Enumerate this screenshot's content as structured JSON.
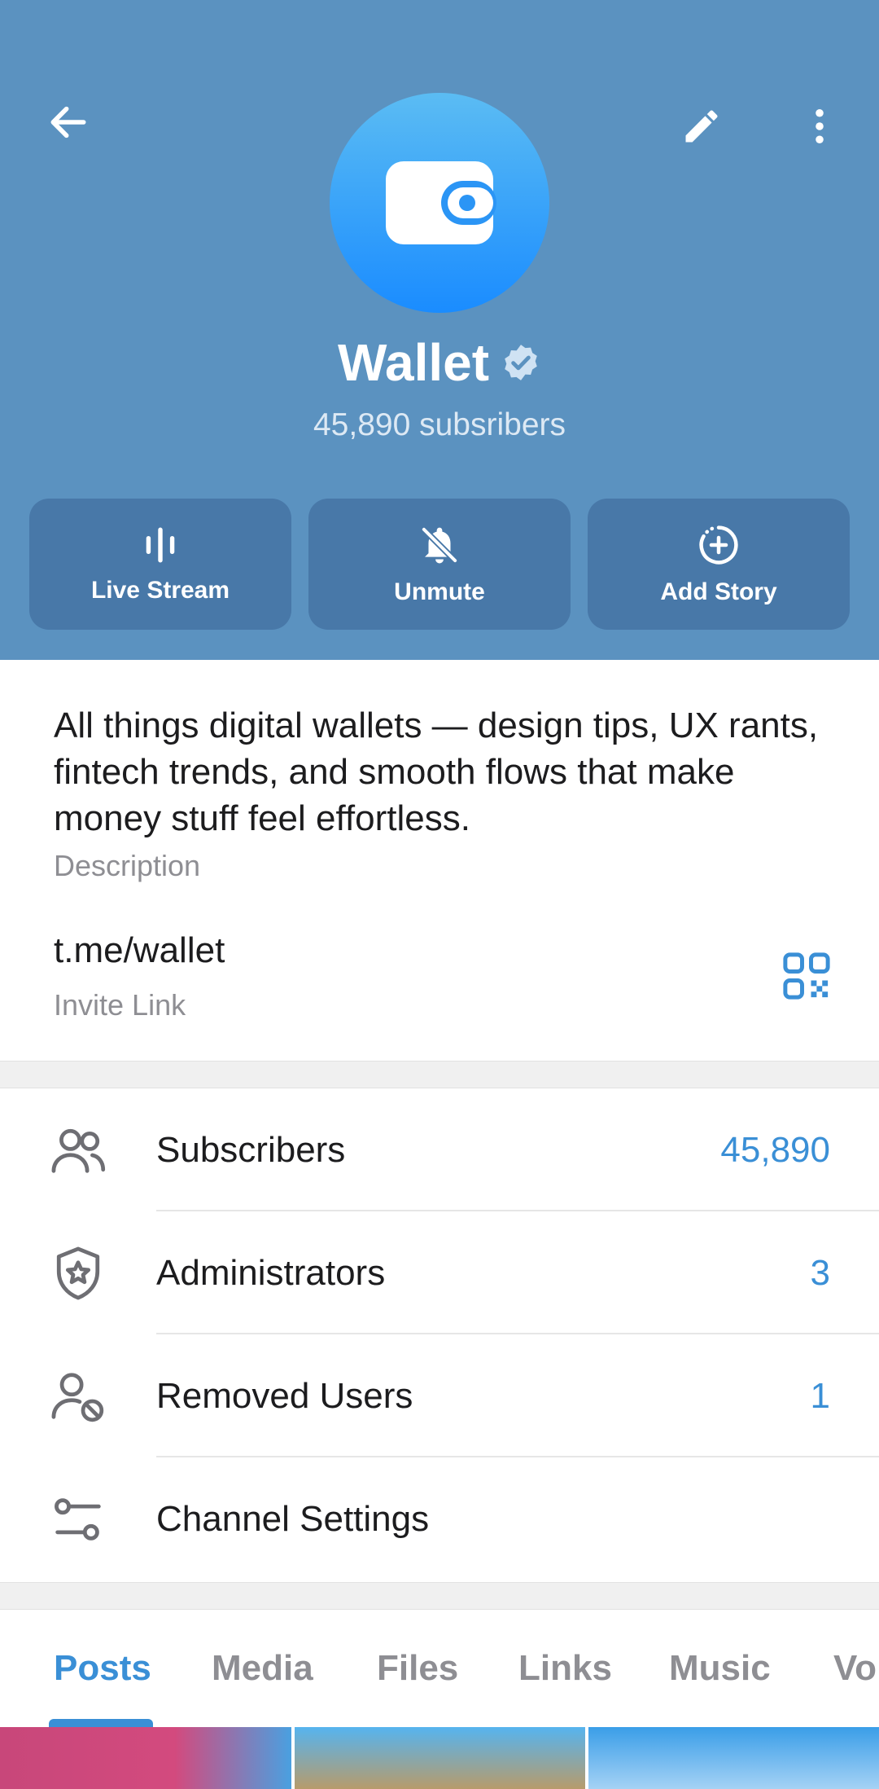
{
  "header": {
    "title": "Wallet",
    "subtitle": "45,890 subsribers",
    "icons": {
      "back": "arrow-left-icon",
      "edit": "pencil-icon",
      "more": "more-vertical-icon",
      "verified": "verified-badge-icon",
      "avatar": "wallet-icon"
    },
    "actions": [
      {
        "label": "Live Stream",
        "icon": "live-stream-icon"
      },
      {
        "label": "Unmute",
        "icon": "bell-off-icon"
      },
      {
        "label": "Add Story",
        "icon": "add-story-icon"
      }
    ]
  },
  "info": {
    "description": "All things digital wallets — design tips, UX rants, fintech trends, and smooth flows that make money stuff feel effortless.",
    "description_label": "Description",
    "link": "t.me/wallet",
    "link_label": "Invite Link",
    "qr_icon": "qr-code-icon"
  },
  "menu": [
    {
      "label": "Subscribers",
      "value": "45,890",
      "icon": "users-icon"
    },
    {
      "label": "Administrators",
      "value": "3",
      "icon": "shield-star-icon"
    },
    {
      "label": "Removed Users",
      "value": "1",
      "icon": "user-blocked-icon"
    },
    {
      "label": "Channel Settings",
      "value": "",
      "icon": "settings-sliders-icon"
    }
  ],
  "tabs": [
    "Posts",
    "Media",
    "Files",
    "Links",
    "Music",
    "Vo"
  ],
  "active_tab": "Posts",
  "colors": {
    "header_bg": "#5b92c0",
    "action_bg": "#4878a8",
    "accent": "#3a8fd6",
    "avatar_top": "#5bbcf3",
    "avatar_bottom": "#1a8cff"
  }
}
